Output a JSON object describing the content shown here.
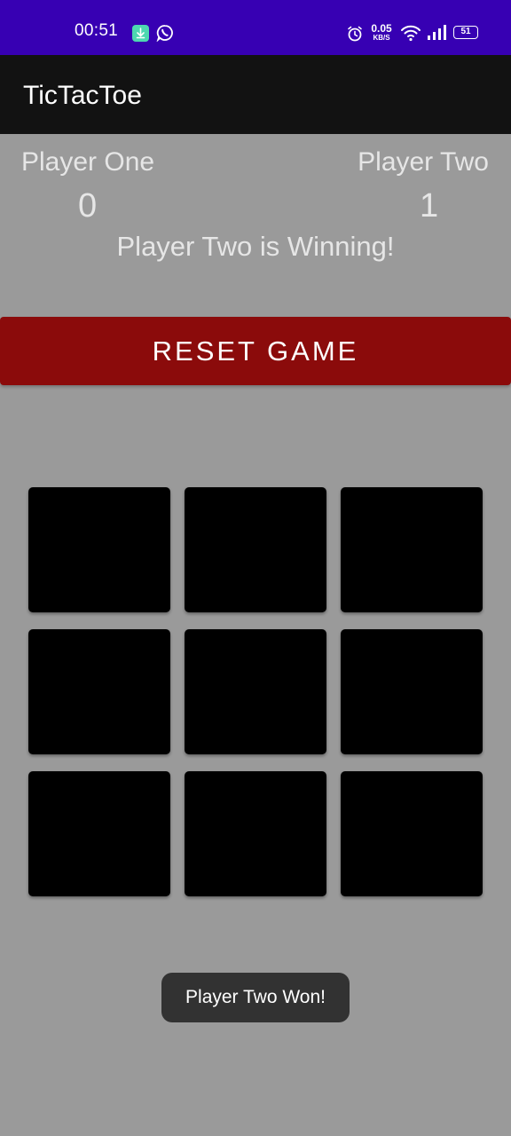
{
  "status_bar": {
    "time": "00:51",
    "net_speed_value": "0.05",
    "net_speed_unit": "KB/S",
    "battery": "51",
    "bg_color": "#3700b3",
    "icons": [
      "download-icon",
      "whatsapp-icon",
      "alarm-icon",
      "wifi-icon",
      "signal-icon",
      "battery-icon"
    ]
  },
  "app_bar": {
    "title": "TicTacToe"
  },
  "scoreboard": {
    "player_one_label": "Player One",
    "player_two_label": "Player Two",
    "player_one_score": "0",
    "player_two_score": "1",
    "status": "Player Two is Winning!"
  },
  "reset_button": {
    "label": "RESET GAME",
    "color": "#8b0b0b"
  },
  "board": {
    "cells": [
      "",
      "",
      "",
      "",
      "",
      "",
      "",
      "",
      ""
    ]
  },
  "toast": {
    "message": "Player Two Won!"
  }
}
